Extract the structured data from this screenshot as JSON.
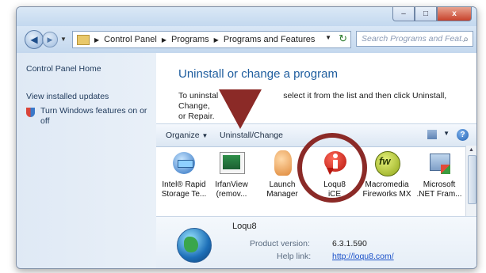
{
  "window": {
    "buttons": {
      "minimize": "–",
      "maximize": "□",
      "close": "x"
    }
  },
  "nav": {
    "back_glyph": "◀",
    "forward_glyph": "▶",
    "breadcrumb": [
      "Control Panel",
      "Programs",
      "Programs and Features"
    ],
    "search_placeholder": "Search Programs and Feat..."
  },
  "sidebar": {
    "items": [
      {
        "label": "Control Panel Home"
      },
      {
        "label": "View installed updates"
      },
      {
        "label": "Turn Windows features on or off"
      }
    ]
  },
  "main": {
    "title": "Uninstall or change a program",
    "description_left": "To uninstal",
    "description_right": "select it from the list and then click Uninstall, Change,",
    "description_line2": "or Repair."
  },
  "toolbar": {
    "organize_label": "Organize",
    "uninstall_label": "Uninstall/Change"
  },
  "programs": [
    {
      "line1": "Intel® Rapid",
      "line2": "Storage Te...",
      "icon": "intel-rapid-storage-icon"
    },
    {
      "line1": "IrfanView",
      "line2": "(remov...",
      "icon": "irfanview-icon"
    },
    {
      "line1": "Launch",
      "line2": "Manager",
      "icon": "launch-manager-icon"
    },
    {
      "line1": "Loqu8",
      "line2": "iCE",
      "icon": "loqu8-icon"
    },
    {
      "line1": "Macromedia",
      "line2": "Fireworks MX",
      "icon": "fireworks-icon"
    },
    {
      "line1": "Microsoft",
      "line2": ".NET Fram...",
      "icon": "dotnet-icon"
    }
  ],
  "details": {
    "name": "Loqu8",
    "version_label": "Product version:",
    "version_value": "6.3.1.590",
    "help_label": "Help link:",
    "help_value": "http://loqu8.com/"
  },
  "colors": {
    "annotation": "#8b2a27",
    "heading": "#1e5d9e",
    "link": "#1a50c8"
  }
}
